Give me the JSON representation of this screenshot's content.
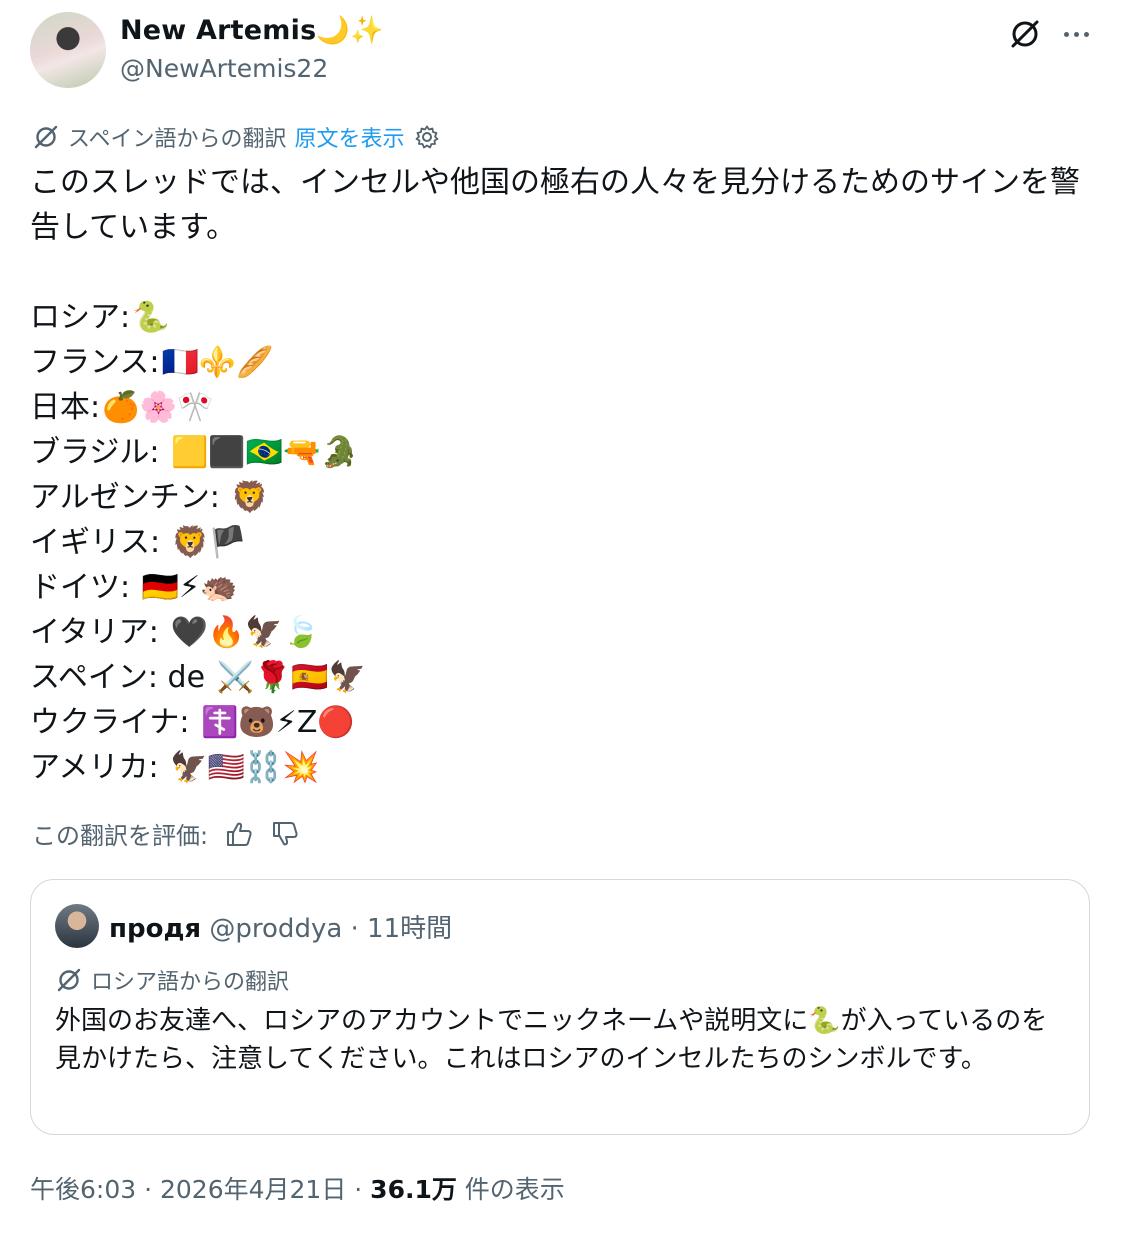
{
  "author": {
    "display_name": "New Artemis",
    "name_emoji": "🌙✨",
    "handle": "@NewArtemis22"
  },
  "translation": {
    "label": "スペイン語からの翻訳",
    "show_original": "原文を表示"
  },
  "tweet": {
    "intro": "このスレッドでは、インセルや他国の極右の人々を見分けるためのサインを警告しています。",
    "lines": [
      {
        "country": "ロシア:",
        "emoji": "🐍"
      },
      {
        "country": "フランス:",
        "emoji": "🇫🇷⚜️🥖"
      },
      {
        "country": "日本:",
        "emoji": "🍊🌸🎌"
      },
      {
        "country": "ブラジル: ",
        "emoji": "🟨⬛🇧🇷🔫🐊"
      },
      {
        "country": "アルゼンチン: ",
        "emoji": "🦁"
      },
      {
        "country": "イギリス: ",
        "emoji": "🦁🏴"
      },
      {
        "country": "ドイツ: ",
        "emoji": "🇩🇪⚡🦔"
      },
      {
        "country": "イタリア: ",
        "emoji": "🖤🔥🦅🍃"
      },
      {
        "country": "スペイン: de ",
        "emoji": "⚔️🌹🇪🇸🦅"
      },
      {
        "country": "ウクライナ: ",
        "emoji": "☦️🐻⚡Z🔴"
      },
      {
        "country": "アメリカ: ",
        "emoji": "🦅🇺🇸⛓️💥"
      }
    ]
  },
  "rate": {
    "label": "この翻訳を評価:"
  },
  "quote": {
    "name": "продя",
    "handle": "@proddya",
    "time": " · 11時間",
    "translation_label": "ロシア語からの翻訳",
    "text": "外国のお友達へ、ロシアのアカウントでニックネームや説明文に🐍が入っているのを見かけたら、注意してください。これはロシアのインセルたちのシンボルです。"
  },
  "meta": {
    "time": "午後6:03",
    "date": "2026年4月21日",
    "views_count": "36.1万",
    "views_label": " 件の表示",
    "separator": " · "
  },
  "colors": {
    "text": "#0f1419",
    "secondary": "#536471",
    "link": "#1d9bf0",
    "border": "#cfd9de"
  }
}
